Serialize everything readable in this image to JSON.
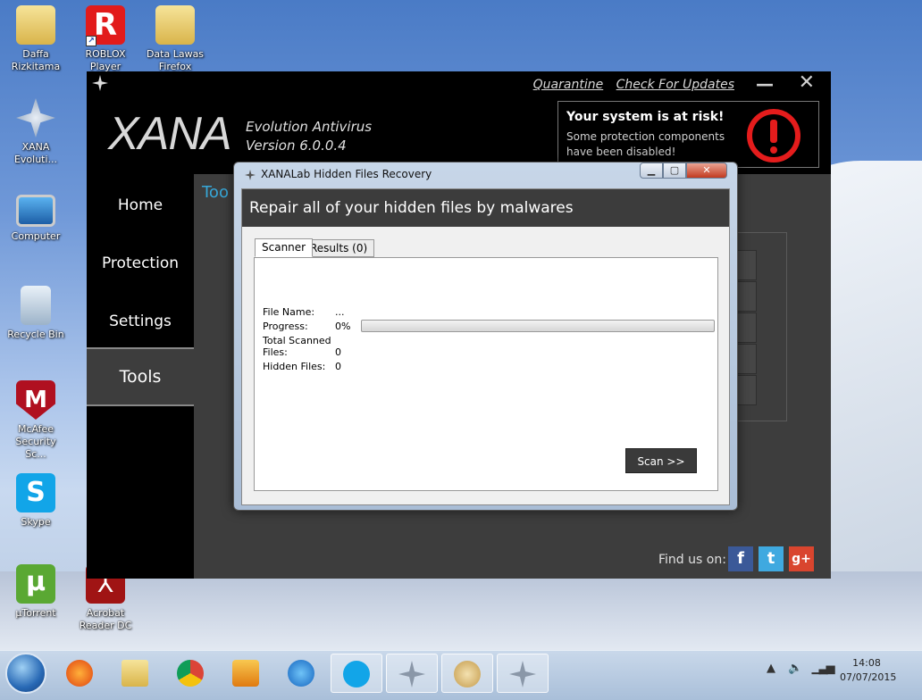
{
  "desktop": {
    "icons": [
      {
        "label": "Daffa Rizkitama"
      },
      {
        "label": "ROBLOX Player"
      },
      {
        "label": "Data Lawas Firefox"
      },
      {
        "label": "XANA Evoluti..."
      },
      {
        "label": "Computer"
      },
      {
        "label": "Recycle Bin"
      },
      {
        "label": "McAfee Security Sc..."
      },
      {
        "label": "Skype"
      },
      {
        "label": "µTorrent"
      },
      {
        "label": "Acrobat Reader DC"
      }
    ]
  },
  "xana": {
    "logo": "XANA",
    "product": "Evolution Antivirus",
    "version": "Version 6.0.0.4",
    "links": {
      "quarantine": "Quarantine",
      "updates": "Check For Updates"
    },
    "risk": {
      "title": "Your system is at risk!",
      "text": "Some protection components have been disabled!"
    },
    "nav": [
      {
        "label": "Home"
      },
      {
        "label": "Protection"
      },
      {
        "label": "Settings"
      },
      {
        "label": "Tools"
      }
    ],
    "tools_header": "Too",
    "find_us": "Find us on:",
    "social": {
      "facebook": "f",
      "twitter": "t",
      "gplus": "g+"
    }
  },
  "dialog": {
    "title": "XANALab Hidden Files Recovery",
    "header": "Repair all of your hidden files by malwares",
    "tabs": [
      {
        "label": "Scanner"
      },
      {
        "label": "Results (0)"
      }
    ],
    "fields": {
      "file_name_label": "File Name:",
      "file_name_value": "...",
      "progress_label": "Progress:",
      "progress_value": "0%",
      "total_label_1": "Total Scanned",
      "total_label_2": "Files:",
      "total_value": "0",
      "hidden_label": "Hidden Files:",
      "hidden_value": "0"
    },
    "progress_fraction": 0.0,
    "scan_button": "Scan >>"
  },
  "taskbar": {
    "time": "14:08",
    "date": "07/07/2015"
  },
  "colors": {
    "accent": "#37a7d8",
    "risk_red": "#e41c1c",
    "dialog_header": "#3c3c3c"
  }
}
